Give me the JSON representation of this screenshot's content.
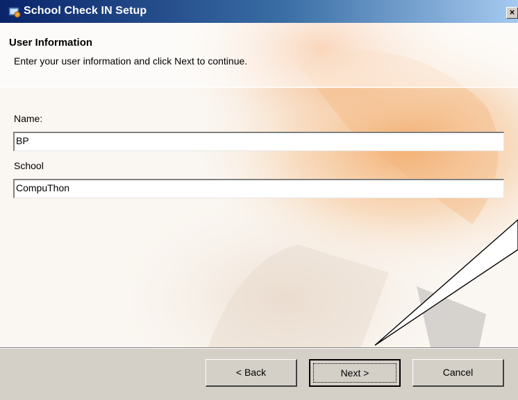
{
  "window": {
    "title": "School Check IN Setup",
    "close_glyph": "×",
    "icon": "installer-icon"
  },
  "header": {
    "title": "User Information",
    "subtitle": "Enter your user information and click Next to continue."
  },
  "form": {
    "name_label": "Name:",
    "name_value": "BP",
    "school_label": "School",
    "school_value": "CompuThon"
  },
  "buttons": {
    "back_label": "< Back",
    "next_label": "Next >",
    "cancel_label": "Cancel",
    "default": "next"
  },
  "colors": {
    "titlebar_start": "#0a246a",
    "titlebar_end": "#a6caf0",
    "face": "#d4d0c8",
    "art_orange": "#f2a25a"
  }
}
